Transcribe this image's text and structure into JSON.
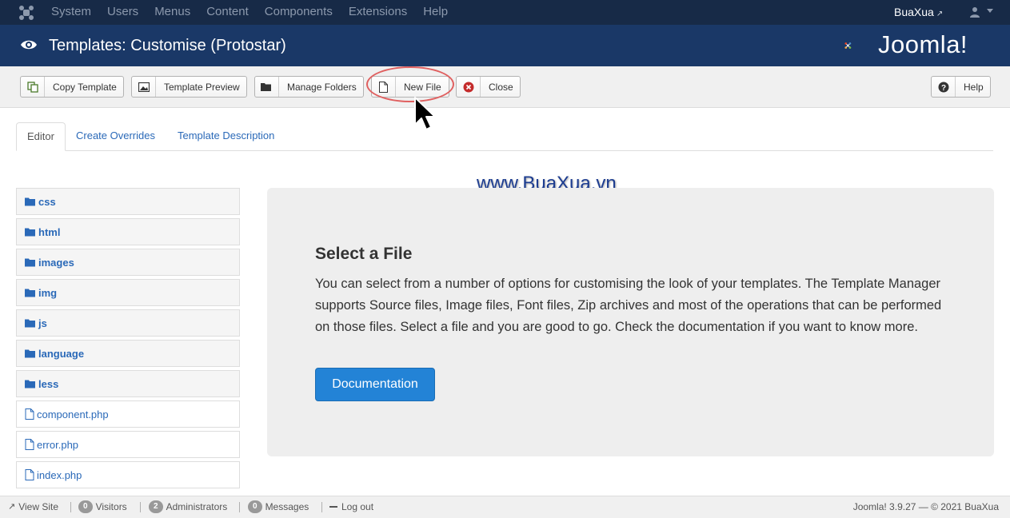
{
  "topnav": {
    "menu": [
      "System",
      "Users",
      "Menus",
      "Content",
      "Components",
      "Extensions",
      "Help"
    ],
    "user_name": "BuaXua"
  },
  "header": {
    "title": "Templates: Customise (Protostar)",
    "brand": "Joomla!"
  },
  "toolbar": {
    "copy_template": "Copy Template",
    "template_preview": "Template Preview",
    "manage_folders": "Manage Folders",
    "new_file": "New File",
    "close": "Close",
    "help": "Help"
  },
  "tabs": [
    "Editor",
    "Create Overrides",
    "Template Description"
  ],
  "watermark": "www.BuaXua.vn",
  "files": {
    "folders": [
      "css",
      "html",
      "images",
      "img",
      "js",
      "language",
      "less"
    ],
    "files": [
      "component.php",
      "error.php",
      "index.php"
    ]
  },
  "main": {
    "heading": "Select a File",
    "description": "You can select from a number of options for customising the look of your templates. The Template Manager supports Source files, Image files, Font files, Zip archives and most of the operations that can be performed on those files. Select a file and you are good to go. Check the documentation if you want to know more.",
    "doc_button": "Documentation"
  },
  "footer": {
    "view_site": "View Site",
    "visitors_count": "0",
    "visitors_label": "Visitors",
    "admins_count": "2",
    "admins_label": "Administrators",
    "messages_count": "0",
    "messages_label": "Messages",
    "logout": "Log out",
    "version": "Joomla! 3.9.27 — © 2021 BuaXua"
  },
  "colors": {
    "topnav_bg": "#172a47",
    "header_bg": "#1a3867",
    "link": "#2a69b8",
    "primary_button": "#2383d6",
    "highlight": "#e06060"
  }
}
